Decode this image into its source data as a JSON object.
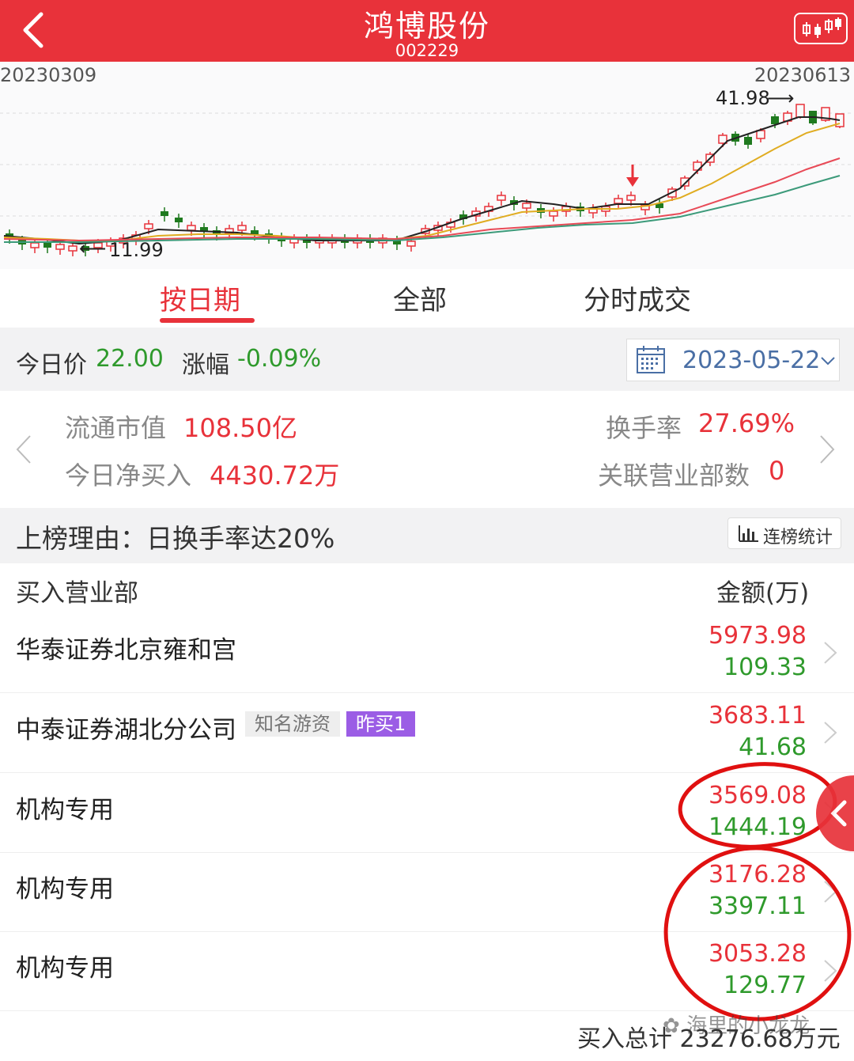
{
  "header": {
    "title": "鸿博股份",
    "code": "002229"
  },
  "kline": {
    "start_date": "20230309",
    "end_date": "20230613",
    "high_label": "41.98",
    "low_label": "11.99"
  },
  "tabs": [
    {
      "label": "按日期",
      "active": true
    },
    {
      "label": "全部",
      "active": false
    },
    {
      "label": "分时成交",
      "active": false
    }
  ],
  "price_bar": {
    "price_label": "今日价",
    "price_value": "22.00",
    "change_label": "涨幅",
    "change_value": "-0.09%",
    "date": "2023-05-22"
  },
  "info": {
    "float_cap_label": "流通市值",
    "float_cap_value": "108.50亿",
    "turnover_label": "换手率",
    "turnover_value": "27.69%",
    "net_buy_label": "今日净买入",
    "net_buy_value": "4430.72万",
    "dept_count_label": "关联营业部数",
    "dept_count_value": "0"
  },
  "reason": {
    "text": "上榜理由：日换手率达20%",
    "stats_button": "连榜统计"
  },
  "table": {
    "col_dept": "买入营业部",
    "col_amount": "金额(万)",
    "rows": [
      {
        "name": "华泰证券北京雍和宫",
        "buy": "5973.98",
        "sell": "109.33",
        "tags": []
      },
      {
        "name": "中泰证券湖北分公司",
        "buy": "3683.11",
        "sell": "41.68",
        "tags": [
          "知名游资",
          "昨买1"
        ]
      },
      {
        "name": "机构专用",
        "buy": "3569.08",
        "sell": "1444.19",
        "tags": []
      },
      {
        "name": "机构专用",
        "buy": "3176.28",
        "sell": "3397.11",
        "tags": []
      },
      {
        "name": "机构专用",
        "buy": "3053.28",
        "sell": "129.77",
        "tags": []
      }
    ]
  },
  "footer": {
    "total": "买入总计 23276.68万元",
    "watermark": "海里的小龙龙"
  },
  "colors": {
    "brand_red": "#e8323a",
    "fall_green": "#2f9a2c",
    "tag_purple": "#9b5de5"
  }
}
